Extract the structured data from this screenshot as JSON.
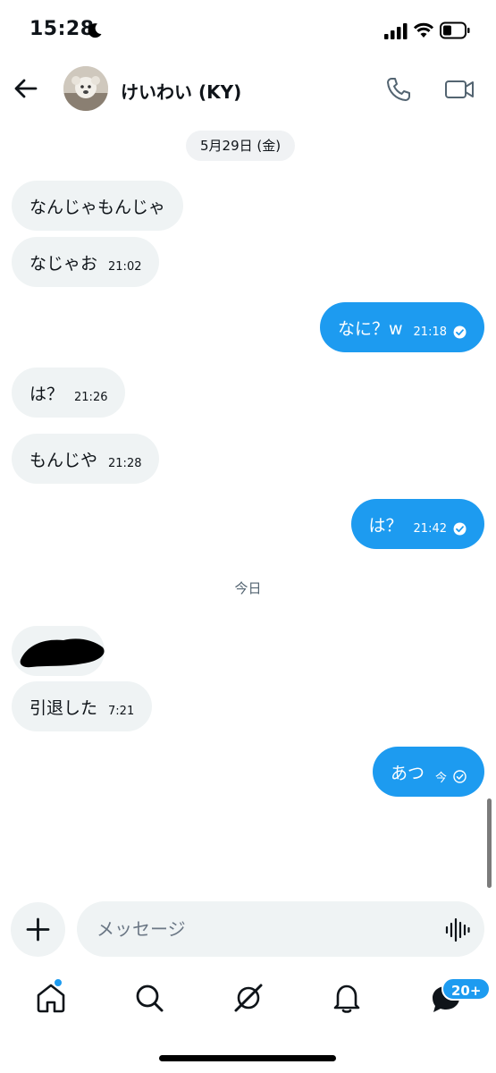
{
  "status_bar": {
    "time": "15:28"
  },
  "header": {
    "contact_name": "けいわい (KY)"
  },
  "conversation": {
    "date_separator": "5月29日 (金)",
    "today_separator": "今日",
    "messages": [
      {
        "direction": "in",
        "text": "なんじゃもんじゃ",
        "time": ""
      },
      {
        "direction": "in",
        "text": "なじゃお",
        "time": "21:02"
      },
      {
        "direction": "out",
        "text": "なに？w",
        "time": "21:18",
        "status": "read"
      },
      {
        "direction": "in",
        "text": "は？",
        "time": "21:26"
      },
      {
        "direction": "in",
        "text": "もんじや",
        "time": "21:28"
      },
      {
        "direction": "out",
        "text": "は？",
        "time": "21:42",
        "status": "read"
      },
      {
        "direction": "in",
        "text": "引退した",
        "time": "7:21"
      },
      {
        "direction": "out",
        "text": "あつ",
        "time": "今",
        "status": "sent"
      }
    ]
  },
  "composer": {
    "placeholder": "メッセージ"
  },
  "bottom_nav": {
    "messages_badge": "20+"
  },
  "colors": {
    "accent": "#1d9bf0",
    "incoming_bubble": "#eff3f4",
    "text": "#0f1419",
    "muted": "#536471"
  },
  "icons": [
    "back-arrow-icon",
    "phone-icon",
    "video-camera-icon",
    "plus-icon",
    "voice-waveform-icon",
    "home-icon",
    "search-icon",
    "grok-icon",
    "bell-icon",
    "messages-icon",
    "check-circle-icon"
  ]
}
